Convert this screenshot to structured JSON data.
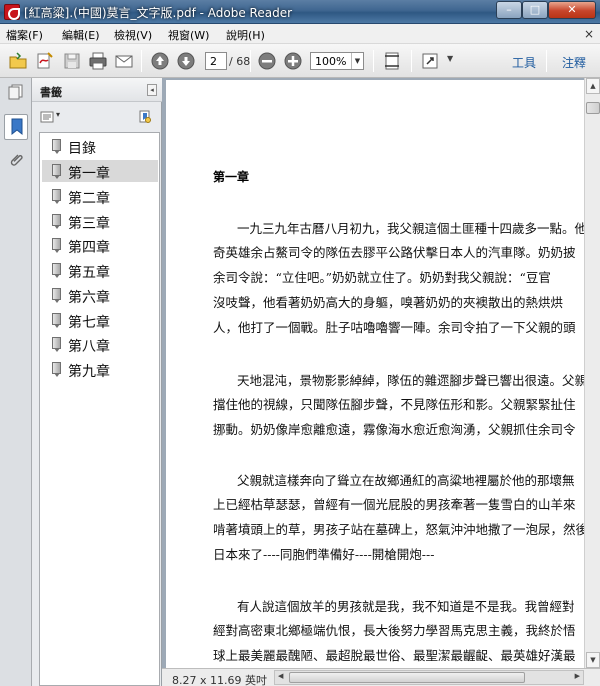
{
  "window": {
    "title": "[紅高粱].(中國)莫言_文字版.pdf - Adobe Reader",
    "min_glyph": "–",
    "max_glyph": "□",
    "close_glyph": "✕"
  },
  "menu": {
    "items": [
      "檔案(F)",
      "編輯(E)",
      "檢視(V)",
      "視窗(W)",
      "說明(H)"
    ],
    "close_glyph": "×"
  },
  "toolbar": {
    "page_current": "2",
    "page_total": "/ 68",
    "zoom": "100%",
    "zoom_arrow": "▼",
    "tools_label": "工具",
    "comment_label": "注釋",
    "icons": [
      "open-icon",
      "create-pdf-icon",
      "save-icon",
      "print-icon",
      "email-icon",
      "page-up-icon",
      "page-down-icon",
      "zoom-out-icon",
      "zoom-in-icon",
      "fit-page-icon",
      "fullscreen-icon"
    ]
  },
  "nav": {
    "title": "書籤",
    "collapse_glyph": "◂",
    "options_glyph": "▾",
    "bookmarks": [
      "目錄",
      "第一章",
      "第二章",
      "第三章",
      "第四章",
      "第五章",
      "第六章",
      "第七章",
      "第八章",
      "第九章"
    ],
    "selected_index": 1
  },
  "document": {
    "chapter_title": "第一章",
    "paragraphs": [
      [
        "一九三九年古曆八月初九，我父親這個土匪種十四歲多一點。他",
        "奇英雄余占鰲司令的隊伍去膠平公路伏擊日本人的汽車隊。奶奶披",
        "余司令說：“立住吧。”奶奶就立住了。奶奶對我父親說：“豆官",
        "沒吱聲，他看著奶奶高大的身軀，嗅著奶奶的夾襖散出的熱烘烘",
        "人，他打了一個戰。肚子咕嚕嚕響一陣。余司令拍了一下父親的頭"
      ],
      [
        "天地混沌，景物影影綽綽，隊伍的雜遝腳步聲已響出很遠。父親",
        "擋住他的視線，只聞隊伍腳步聲，不見隊伍形和影。父親緊緊扯住",
        "挪動。奶奶像岸愈離愈遠，霧像海水愈近愈洶湧，父親抓住余司令"
      ],
      [
        "父親就這樣奔向了聳立在故鄉通紅的高粱地裡屬於他的那壞無",
        "上已經枯草瑟瑟，曾經有一個光屁股的男孩牽著一隻雪白的山羊來",
        "啃著墳頭上的草，男孩子站在墓碑上，怒氣沖沖地撒了一泡尿，然後",
        "日本來了----同胞們準備好----開槍開炮---"
      ],
      [
        "有人說這個放羊的男孩就是我，我不知道是不是我。我曾經對",
        "經對高密東北鄉極端仇恨，長大後努力學習馬克思主義，我終於悟",
        "球上最美麗最醜陋、最超脫最世俗、最聖潔最齷齪、最英雄好漢最"
      ]
    ]
  },
  "scroll": {
    "up": "▲",
    "down": "▼",
    "left": "◀",
    "right": "▶"
  },
  "status": {
    "page_size": "8.27 x 11.69 英吋"
  }
}
